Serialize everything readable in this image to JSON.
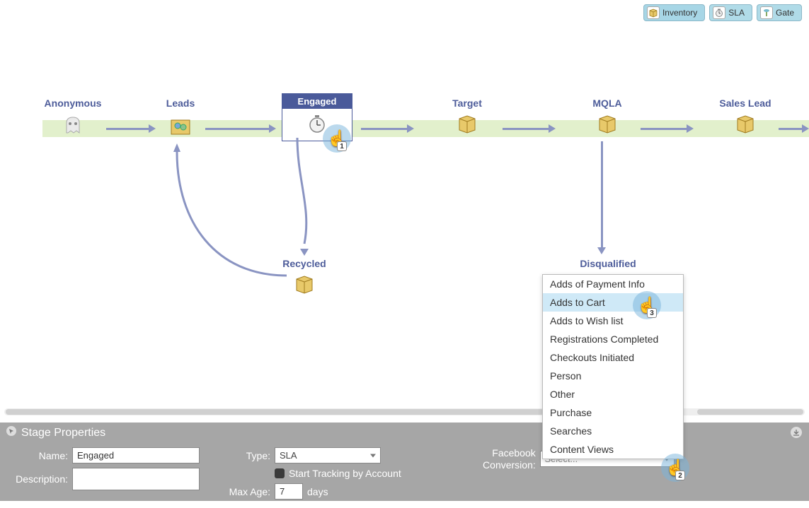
{
  "toolbar": [
    {
      "label": "Inventory",
      "icon": "box-icon",
      "active": true
    },
    {
      "label": "SLA",
      "icon": "clock-icon",
      "active": false
    },
    {
      "label": "Gate",
      "icon": "gate-icon",
      "active": false
    }
  ],
  "stages": {
    "anonymous": "Anonymous",
    "leads": "Leads",
    "engaged": "Engaged",
    "target": "Target",
    "mqla": "MQLA",
    "sales_lead": "Sales Lead",
    "recycled": "Recycled",
    "disqualified": "Disqualified"
  },
  "cursor_badges": [
    "1",
    "2",
    "3"
  ],
  "dropdown": {
    "items": [
      "Adds of Payment Info",
      "Adds to Cart",
      "Adds to Wish list",
      "Registrations Completed",
      "Checkouts Initiated",
      "Person",
      "Other",
      "Purchase",
      "Searches",
      "Content Views"
    ],
    "highlight_index": 1
  },
  "properties": {
    "title": "Stage Properties",
    "name_label": "Name:",
    "name_value": "Engaged",
    "description_label": "Description:",
    "description_value": "",
    "type_label": "Type:",
    "type_value": "SLA",
    "start_tracking_label": "Start Tracking by Account",
    "max_age_label": "Max Age:",
    "max_age_value": "7",
    "max_age_unit": "days",
    "fb_label_line1": "Facebook",
    "fb_label_line2": "Conversion:",
    "fb_placeholder": "Select..."
  }
}
